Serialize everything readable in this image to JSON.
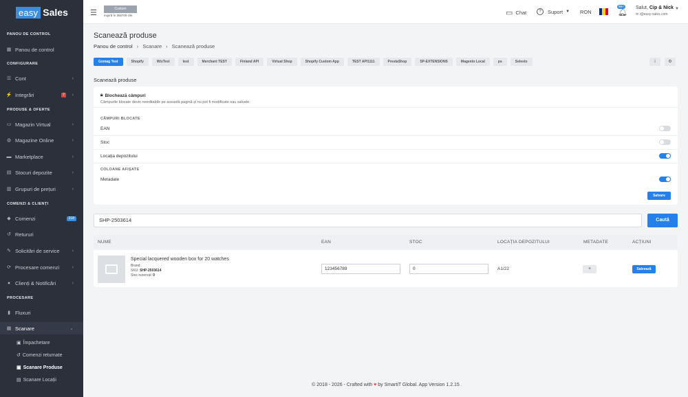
{
  "brand": {
    "box": "easy",
    "text": "Sales"
  },
  "topbar": {
    "plan_label": "Custom",
    "plan_expiry": "expiră în 355709 zile",
    "chat": "Chat",
    "support": "Suport",
    "currency": "RON",
    "notif_count": "99+",
    "greeting": "Salut,",
    "user_name": "Cip & Nick",
    "email": "i@easy-sales.com"
  },
  "sidebar": {
    "sections": {
      "dashboard": "PANOU DE CONTROL",
      "config": "CONFIGURARE",
      "products": "PRODUSE & OFERTE",
      "orders": "COMENZI & CLIENȚI",
      "processing": "PROCESARE"
    },
    "items": {
      "dashboard": "Panou de control",
      "account": "Cont",
      "integrations": "Integrări",
      "integrations_badge": "2",
      "virtual_store": "Magazin Virtual",
      "online_stores": "Magazine Online",
      "marketplace": "Marketplace",
      "stocks": "Stocuri depozite",
      "price_groups": "Grupuri de prețuri",
      "orders": "Comenzi",
      "orders_badge": "318",
      "returns": "Retururi",
      "service": "Solicitări de service",
      "order_processing": "Procesare comenzi",
      "clients": "Clienți & Notificări",
      "flows": "Fluxuri",
      "scan": "Scanare"
    },
    "sub": {
      "packing": "Împachetare",
      "returned": "Comenzi returnate",
      "scan_products": "Scanare Produse",
      "scan_locations": "Scanare Locații"
    }
  },
  "page": {
    "title": "Scanează produse",
    "breadcrumb": [
      "Panou de control",
      "Scanare",
      "Scanează produse"
    ]
  },
  "tabs": [
    "Gomag Test",
    "Shopify",
    "WixTest",
    "test",
    "Merchant TEST",
    "Finland API",
    "Virtual Shop",
    "Shopify Custom App",
    "TEST API1111",
    "PrestaShop",
    "SP-EXTENSIONS",
    "Magento Local",
    "ps",
    "Selesto"
  ],
  "tab_extra": {
    "info": "i",
    "settings": "⚙"
  },
  "section": {
    "title": "Scanează produse",
    "lock_title": "Blochează câmpuri",
    "lock_desc": "Câmpurile blocate devin needitabile pe această pagină și nu pot fi modificate sau salvate.",
    "blocked_label": "CÂMPURI BLOCATE",
    "blocked": [
      {
        "label": "EAN",
        "on": false
      },
      {
        "label": "Stoc",
        "on": false
      },
      {
        "label": "Locația depozitului",
        "on": true
      }
    ],
    "columns_label": "COLOANE AFIȘATE",
    "columns": [
      {
        "label": "Metadate",
        "on": true
      }
    ],
    "save": "Salvare"
  },
  "search": {
    "value": "SHP-2503614",
    "button": "Caută"
  },
  "table": {
    "headers": [
      "NUME",
      "EAN",
      "STOC",
      "LOCAȚIA DEPOZITULUI",
      "METADATE",
      "ACȚIUNI"
    ],
    "rows": [
      {
        "name": "Special lacquered wooden box for 20 watches",
        "brand_label": "Brand:",
        "sku_label": "SKU:",
        "sku": "SHP-2503614",
        "reserved_label": "Stoc rezervat:",
        "reserved": "0",
        "ean": "123456789",
        "stock": "0",
        "location": "A1/22",
        "meta": "+",
        "action": "Salvează"
      }
    ]
  },
  "footer": {
    "left": "© 2018 - 2026 - Crafted with",
    "heart": "♥",
    "right": "by SmartiT Global. App Version 1.2.15"
  },
  "colors": {
    "primary": "#2680ea",
    "sidebar": "#2b303b",
    "badge_red": "#e53e3e"
  }
}
